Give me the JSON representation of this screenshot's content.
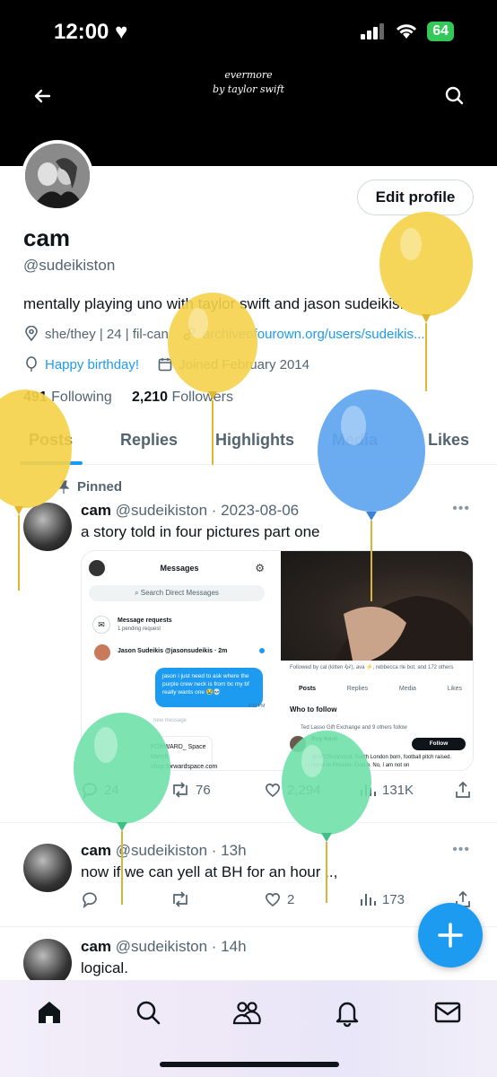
{
  "status_bar": {
    "time": "12:00",
    "battery": "64"
  },
  "banner": {
    "line1": "evermore",
    "line2": "by taylor swift"
  },
  "profile": {
    "edit_label": "Edit profile",
    "name": "cam",
    "handle": "@sudeikiston",
    "bio": "mentally playing uno with taylor swift and jason sudeikis.",
    "pronouns_line": "she/they | 24 | fil-can",
    "link": "archiveofourown.org/users/sudeikis...",
    "birthday": "Happy birthday!",
    "joined": "Joined February 2014",
    "following_count": "491",
    "following_label": "Following",
    "followers_count": "2,210",
    "followers_label": "Followers"
  },
  "tabs": [
    "Posts",
    "Replies",
    "Highlights",
    "Media",
    "Likes"
  ],
  "pinned_label": "Pinned",
  "tweets": [
    {
      "name": "cam",
      "meta": "@sudeikiston · 2023-08-06",
      "text": "a story told in four pictures part one",
      "replies": "24",
      "retweets": "76",
      "likes": "2,294",
      "views": "131K"
    },
    {
      "name": "cam",
      "meta": "@sudeikiston · 13h",
      "text": "now if we can yell at BH for an hour ,.,",
      "replies": "",
      "retweets": "",
      "likes": "2",
      "views": "173"
    },
    {
      "name": "cam",
      "meta": "@sudeikiston · 14h",
      "text": "logical."
    }
  ],
  "media": {
    "messages_title": "Messages",
    "search_dm": "Search Direct Messages",
    "message_requests": "Message requests",
    "pending": "1 pending request",
    "jason_row": "Jason Sudeikis @jasonsudeikis · 2m",
    "bubble": "jason i just need to ask where the purple crew neck is from bc my bf really wants one 😭💀",
    "bubble_time": "6:11 PM",
    "new_message": "new message",
    "card_text": "FORWARD_ Space Merch shop.forwardspace.com",
    "followed_by": "Followed by cal (kitten 🎶), ava ⚡, rebbecca rle bot, and 172 others",
    "r_tabs": [
      "Posts",
      "Replies",
      "Media",
      "Likes"
    ],
    "who_to_follow": "Who to follow",
    "ted_line": "Ted Lasso Gift Exchange and 9 others follow",
    "roy": "Roy Kent",
    "follow_btn": "Follow",
    "roy_bio": "@AFCRichmond. South London born, football pitch raised. Uncle to Phoebe. Coach. No, I am not on"
  },
  "colors": {
    "accent": "#1d9bf0",
    "balloon_yellow": "#f5d24a",
    "balloon_blue": "#5ea5f0",
    "balloon_green": "#6ee0a8"
  }
}
